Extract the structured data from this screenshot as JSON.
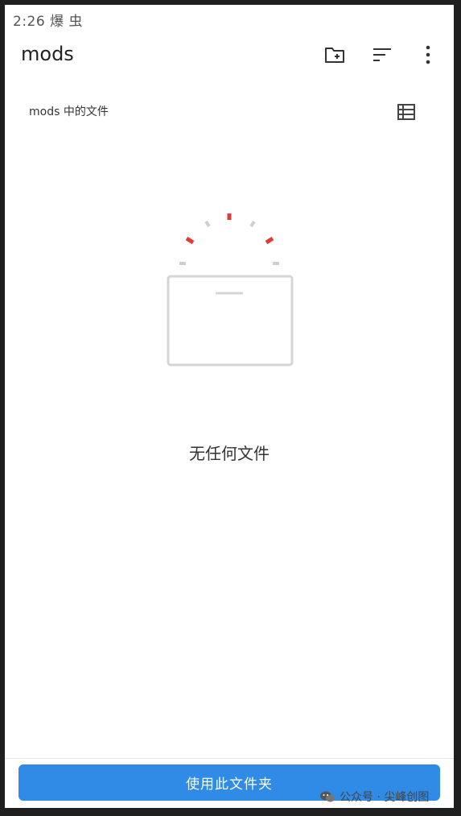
{
  "status_bar": {
    "time_and_icons": "2:26 爆 虫"
  },
  "header": {
    "title": "mods",
    "actions": [
      {
        "icon": "new-folder-icon"
      },
      {
        "icon": "sort-icon"
      },
      {
        "icon": "more-vert-icon"
      }
    ]
  },
  "subheader": {
    "label": "mods 中的文件",
    "view_toggle_icon": "list-view-icon"
  },
  "empty_state": {
    "message": "无任何文件"
  },
  "footer": {
    "button_label": "使用此文件夹"
  },
  "watermark": {
    "text": "公众号 · 尖峰创图",
    "icon": "wechat-icon"
  },
  "colors": {
    "accent": "#2f8be6",
    "spark_red": "#e53935",
    "spark_gray": "#cfcfcf",
    "folder_outline": "#d5d5d5"
  }
}
